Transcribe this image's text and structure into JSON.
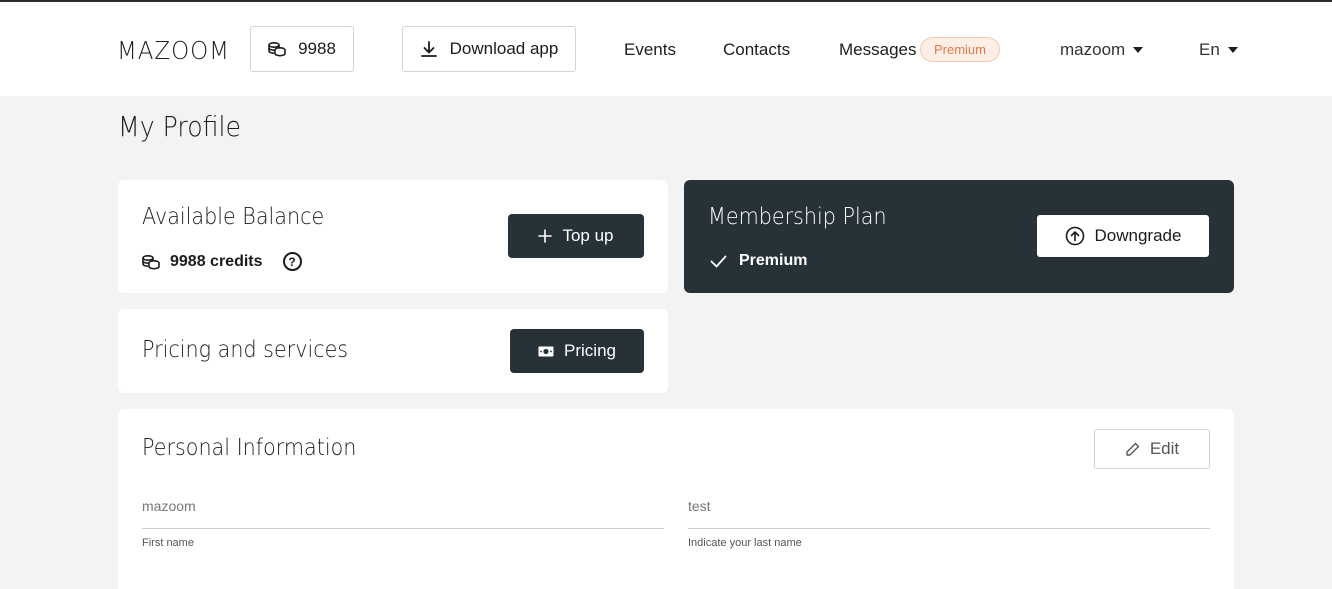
{
  "header": {
    "logo": "MAZOOM",
    "credits_value": "9988",
    "download_label": "Download app",
    "nav": {
      "events": "Events",
      "contacts": "Contacts",
      "messages": "Messages"
    },
    "premium_badge": "Premium",
    "user_name": "mazoom",
    "language": "En"
  },
  "page": {
    "title": "My Profile"
  },
  "balance": {
    "title": "Available Balance",
    "credits_text": "9988 credits",
    "help_icon": "question-circle-icon",
    "topup_label": "Top up"
  },
  "membership": {
    "title": "Membership Plan",
    "plan": "Premium",
    "downgrade_label": "Downgrade"
  },
  "pricing": {
    "title": "Pricing and services",
    "button_label": "Pricing"
  },
  "personal": {
    "title": "Personal Information",
    "edit_label": "Edit",
    "first_name": {
      "value": "mazoom",
      "hint": "First name"
    },
    "last_name": {
      "value": "test",
      "hint": "Indicate your last name"
    }
  },
  "colors": {
    "dark": "#263238",
    "background": "#f3f3f3",
    "premium_text": "#e07a4a",
    "premium_bg": "#fdeee6"
  }
}
